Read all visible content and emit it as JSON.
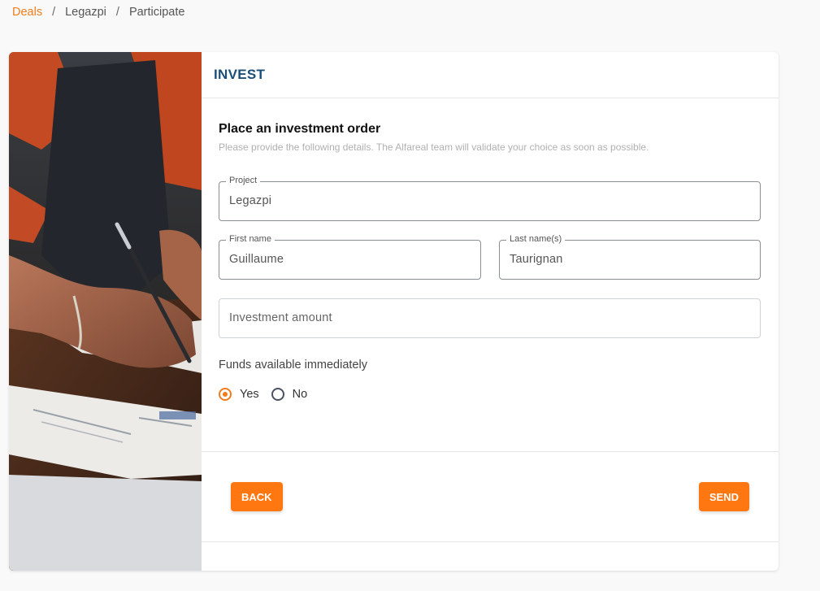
{
  "breadcrumb": {
    "items": [
      "Deals",
      "Legazpi",
      "Participate"
    ],
    "separator": "/"
  },
  "header": {
    "title": "INVEST"
  },
  "form": {
    "title": "Place an investment order",
    "subtitle": "Please provide the following details. The Alfareal team will validate your choice as soon as possible.",
    "project": {
      "label": "Project",
      "value": "Legazpi"
    },
    "first_name": {
      "label": "First name",
      "value": "Guillaume"
    },
    "last_name": {
      "label": "Last name(s)",
      "value": "Taurignan"
    },
    "amount": {
      "placeholder": "Investment amount"
    },
    "funds": {
      "label": "Funds available immediately",
      "options": [
        "Yes",
        "No"
      ],
      "selected": "Yes"
    }
  },
  "actions": {
    "back": "BACK",
    "send": "SEND"
  },
  "colors": {
    "accent": "#ff7711",
    "title": "#1b4f79"
  }
}
